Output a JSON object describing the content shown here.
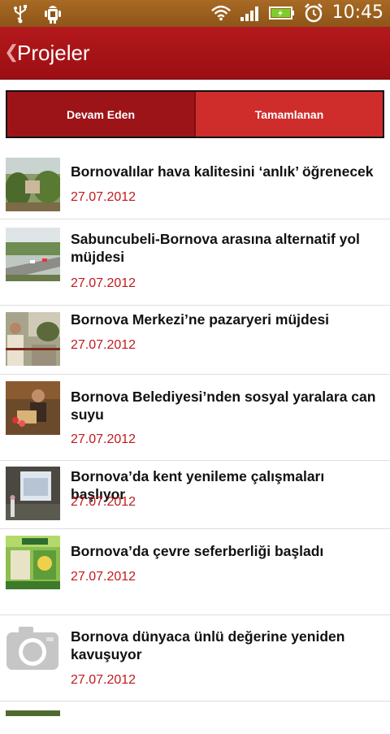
{
  "status_bar": {
    "time": "10:45",
    "left_icons": [
      "usb-icon",
      "android-debug-icon"
    ],
    "right_icons": [
      "wifi-icon",
      "signal-icon",
      "battery-icon",
      "alarm-icon"
    ]
  },
  "action_bar": {
    "title": "Projeler",
    "back_icon": "chevron-left-icon"
  },
  "tabs": [
    {
      "label": "Devam Eden",
      "selected": true
    },
    {
      "label": "Tamamlanan",
      "selected": false
    }
  ],
  "items": [
    {
      "title": "Bornovalılar hava kalitesini ‘anlık’ öğrenecek",
      "date": "27.07.2012",
      "thumb": "photo-trees"
    },
    {
      "title": "Sabuncubeli-Bornova arasına alternatif yol müjdesi",
      "date": "27.07.2012",
      "thumb": "photo-road"
    },
    {
      "title": "Bornova Merkezi’ne pazaryeri müjdesi",
      "date": "27.07.2012",
      "thumb": "photo-person-street"
    },
    {
      "title": "Bornova Belediyesi’nden sosyal yaralara can suyu",
      "date": "27.07.2012",
      "thumb": "photo-event"
    },
    {
      "title": "Bornova’da kent yenileme çalışmaları başlıyor",
      "date": "27.07.2012",
      "thumb": "photo-presentation"
    },
    {
      "title": "Bornova’da çevre seferberliği başladı",
      "date": "27.07.2012",
      "thumb": "photo-poster"
    },
    {
      "title": "Bornova dünyaca ünlü değerine yeniden kavuşuyor",
      "date": "27.07.2012",
      "thumb": "camera-placeholder-icon"
    }
  ],
  "colors": {
    "action_bar": "#a8141a",
    "date": "#c01a1d",
    "tab_selected": "#9c1418",
    "tab_unselected": "#cf2c2c"
  }
}
